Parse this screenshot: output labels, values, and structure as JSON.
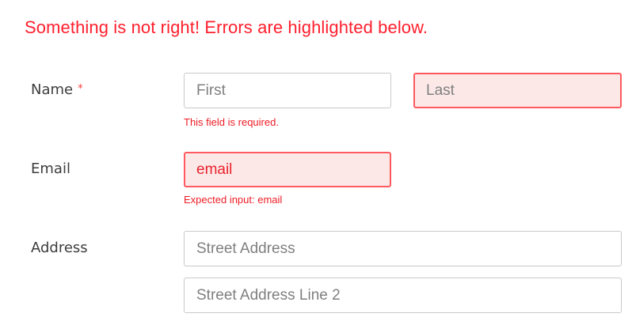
{
  "form": {
    "error_banner": "Something is not right! Errors are highlighted below.",
    "required_marker": "*",
    "name": {
      "label": "Name",
      "first_placeholder": "First",
      "last_placeholder": "Last",
      "error_message": "This field is required."
    },
    "email": {
      "label": "Email",
      "value": "email",
      "error_message": "Expected input: email"
    },
    "address": {
      "label": "Address",
      "line1_placeholder": "Street Address",
      "line2_placeholder": "Street Address Line 2"
    }
  },
  "colors": {
    "error_text": "#ff1f2d",
    "error_border": "#ff5a5f",
    "error_background": "#fde8e8",
    "input_border": "#c9c9c9",
    "label_text": "#3d3d3d"
  }
}
